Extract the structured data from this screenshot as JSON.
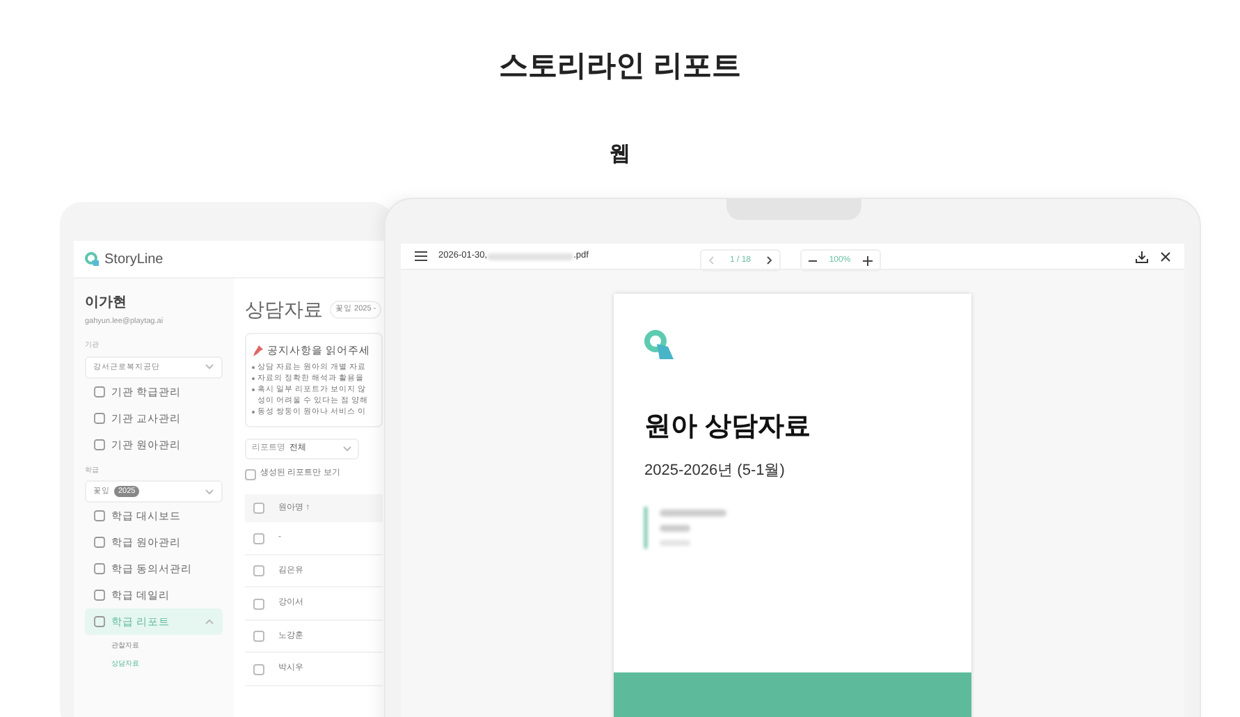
{
  "page_title": "스토리라인 리포트",
  "section_label": "웹",
  "background_app": {
    "logo": "StoryLine",
    "user": {
      "name": "이가현",
      "email": "gahyun.lee@playtag.ai"
    },
    "org_label": "기관",
    "org_select": "강서근로복지공단",
    "org_menu": [
      "기관 학급관리",
      "기관 교사관리",
      "기관 원아관리"
    ],
    "class_label": "학급",
    "class_select": "꽃잎",
    "class_badge": "2025",
    "class_menu": [
      {
        "label": "학급 대시보드",
        "selected": false,
        "expanded": false
      },
      {
        "label": "학급 원아관리",
        "selected": false,
        "expanded": false
      },
      {
        "label": "학급 동의서관리",
        "selected": false,
        "expanded": false
      },
      {
        "label": "학급 데일리",
        "selected": false,
        "expanded": false
      },
      {
        "label": "학급 리포트",
        "selected": true,
        "expanded": true
      }
    ],
    "submenu": [
      {
        "label": "관찰자료",
        "selected": false
      },
      {
        "label": "상담자료",
        "selected": true
      }
    ],
    "main_title": "상담자료",
    "class_chip": "꽃잎 2025 -",
    "notice": {
      "title": "공지사항을 읽어주세",
      "items": [
        "상담 자료는 원아의 개별 자료",
        "자료의 정확한 해석과 활용을",
        "혹시 일부 리포트가 보이지 않",
        "동성 쌍둥이 원아나 서비스 이"
      ],
      "item_3_continued": "성이 어려울 수 있다는 점 양해"
    },
    "filter": {
      "label": "리포트명",
      "value": "전체"
    },
    "only_generated": {
      "label": "생성된 리포트만 보기",
      "checked": false
    },
    "table": {
      "header_checked": false,
      "columns": [
        "원아명 ↑"
      ],
      "rows": [
        {
          "name": "-",
          "checked": false
        },
        {
          "name": "김은유",
          "checked": false
        },
        {
          "name": "강이서",
          "checked": false
        },
        {
          "name": "노강훈",
          "checked": false
        },
        {
          "name": "박시우",
          "checked": false
        }
      ]
    }
  },
  "viewer": {
    "file_name_start": "2026-01-30,",
    "file_name_end": ".pdf",
    "page_indicator": "1 / 18",
    "zoom": "100%",
    "document": {
      "title": "원아 상담자료",
      "period": "2025-2026년 (5-1월)"
    }
  }
}
